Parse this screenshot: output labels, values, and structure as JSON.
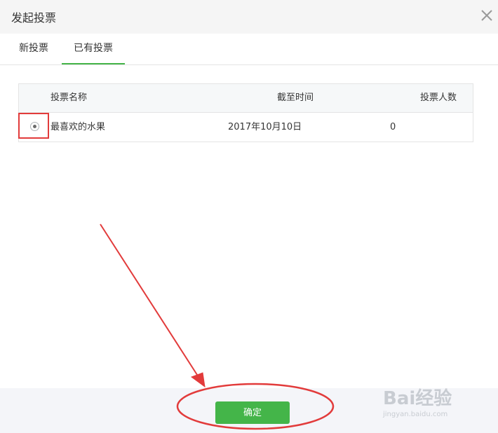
{
  "dialog": {
    "title": "发起投票",
    "close_icon": "close-icon"
  },
  "tabs": [
    {
      "label": "新投票",
      "active": false
    },
    {
      "label": "已有投票",
      "active": true
    }
  ],
  "table": {
    "headers": [
      "投票名称",
      "截至时间",
      "投票人数"
    ],
    "rows": [
      {
        "selected": true,
        "name": "最喜欢的水果",
        "deadline": "2017年10月10日",
        "voters": "0"
      }
    ]
  },
  "footer": {
    "confirm_label": "确定"
  },
  "watermark": {
    "logo": "Bai经验",
    "url": "jingyan.baidu.com"
  },
  "colors": {
    "accent": "#44b549",
    "annotation": "#e23b3b",
    "title_bar": "#f5f5f5",
    "footer": "#f4f5f9"
  }
}
